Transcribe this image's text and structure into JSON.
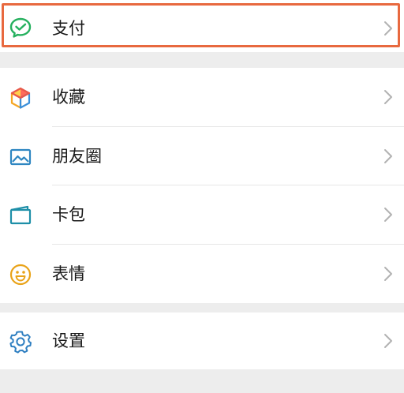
{
  "menu": {
    "pay": {
      "label": "支付",
      "icon": "wechat-pay-icon"
    },
    "favorites": {
      "label": "收藏",
      "icon": "cube-icon"
    },
    "moments": {
      "label": "朋友圈",
      "icon": "picture-icon"
    },
    "cards": {
      "label": "卡包",
      "icon": "card-wallet-icon"
    },
    "stickers": {
      "label": "表情",
      "icon": "smiley-icon"
    },
    "settings": {
      "label": "设置",
      "icon": "gear-icon"
    }
  },
  "colors": {
    "highlight_border": "#e8693f",
    "pay_green": "#25b05e",
    "moments_blue": "#2e86c1",
    "cards_teal": "#1e8fa8",
    "sticker_yellow": "#e9a319",
    "settings_blue": "#2f7fc1",
    "chevron": "#b2b2b2",
    "separator_bg": "#ededed"
  }
}
